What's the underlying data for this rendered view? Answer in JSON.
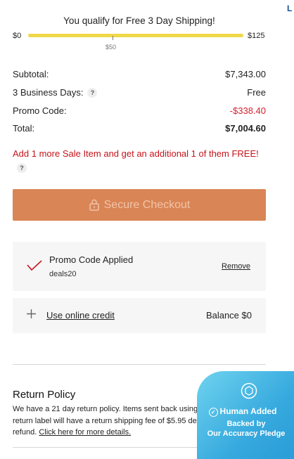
{
  "shipping": {
    "message": "You qualify for Free 3 Day Shipping!",
    "min_label": "$0",
    "mid_label": "$50",
    "max_label": "$125",
    "progress": 1.0,
    "track_color": "#efe7a6",
    "fill_color": "#f0d84a"
  },
  "summary": {
    "subtotal_label": "Subtotal:",
    "subtotal_value": "$7,343.00",
    "delivery_label": "3 Business Days:",
    "delivery_help": "?",
    "delivery_value": "Free",
    "promo_label": "Promo Code:",
    "promo_value": "-$338.40",
    "total_label": "Total:",
    "total_value": "$7,004.60"
  },
  "sale_message": {
    "text": "Add 1 more Sale Item and get an additional 1 of them FREE!",
    "help": "?",
    "color": "#c4141b"
  },
  "checkout": {
    "label": "Secure Checkout",
    "icon": "lock-icon",
    "color": "#d98556"
  },
  "promo_card": {
    "title": "Promo Code Applied",
    "code": "deals20",
    "remove_label": "Remove",
    "icon": "check-icon"
  },
  "credit_card": {
    "icon": "plus-icon",
    "link_label": "Use online credit",
    "balance": "Balance $0"
  },
  "return_policy": {
    "title": "Return Policy",
    "body": "We have a 21 day return policy. Items sent back using our prepaid return label will have a return shipping fee of $5.95 deducted from your refund.",
    "link": "Click here for more details."
  },
  "edge_text": "L",
  "accuracy_badge": {
    "line1": "Human Added",
    "line2": "Backed by",
    "line3": "Our Accuracy Pledge",
    "icon": "shield-icon"
  }
}
